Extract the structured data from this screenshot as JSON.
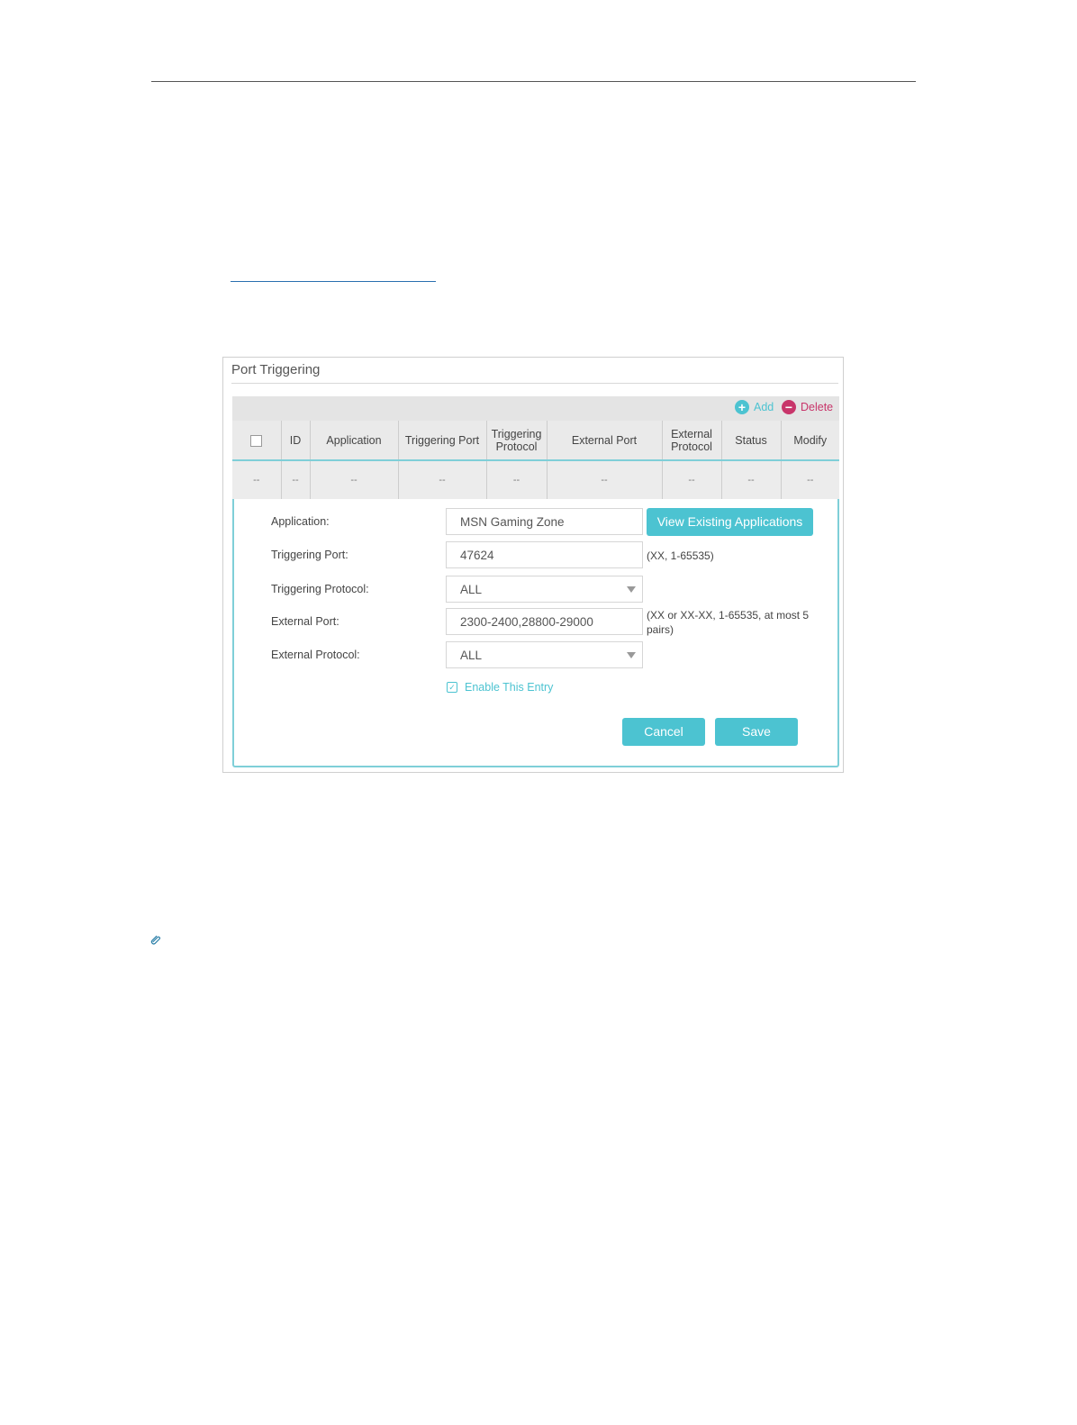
{
  "panel": {
    "title": "Port Triggering"
  },
  "toolbar": {
    "add_label": "Add",
    "delete_label": "Delete",
    "add_icon": "plus-circle-icon",
    "delete_icon": "minus-circle-icon"
  },
  "table": {
    "columns": [
      "",
      "ID",
      "Application",
      "Triggering Port",
      "Triggering Protocol",
      "External Port",
      "External Protocol",
      "Status",
      "Modify"
    ],
    "rows": [
      [
        "--",
        "--",
        "--",
        "--",
        "--",
        "--",
        "--",
        "--",
        "--"
      ]
    ]
  },
  "form": {
    "application": {
      "label": "Application:",
      "value": "MSN Gaming Zone"
    },
    "view_button": "View Existing Applications",
    "triggering_port": {
      "label": "Triggering Port:",
      "value": "47624",
      "hint": "(XX, 1-65535)"
    },
    "triggering_protocol": {
      "label": "Triggering Protocol:",
      "value": "ALL"
    },
    "external_port": {
      "label": "External Port:",
      "value": "2300-2400,28800-29000",
      "hint": "(XX or XX-XX, 1-65535, at most 5 pairs)"
    },
    "external_protocol": {
      "label": "External Protocol:",
      "value": "ALL"
    },
    "enable_entry": {
      "label": "Enable This Entry",
      "checked": true
    },
    "cancel_label": "Cancel",
    "save_label": "Save"
  },
  "colors": {
    "accent": "#4cc3d1",
    "delete": "#c8356a",
    "table_border": "#7fcfd8"
  }
}
